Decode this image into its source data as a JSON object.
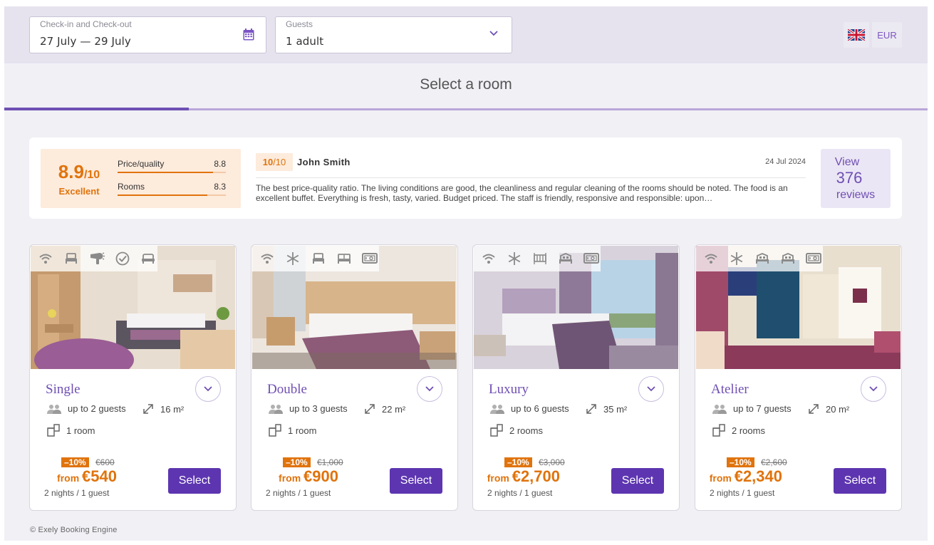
{
  "search": {
    "dates_label": "Check-in and Check-out",
    "dates_value": "27 July — 29 July",
    "guests_label": "Guests",
    "guests_value": "1 adult"
  },
  "header": {
    "currency": "EUR",
    "language_icon": "uk-flag-icon"
  },
  "page_title": "Select a room",
  "progress": {
    "fraction": 0.2
  },
  "rating": {
    "score": "8.9",
    "out_of": "/10",
    "word": "Excellent",
    "criteria": [
      {
        "name": "Price/quality",
        "value": "8.8",
        "fraction": 0.88
      },
      {
        "name": "Rooms",
        "value": "8.3",
        "fraction": 0.83
      }
    ]
  },
  "review": {
    "score": "10",
    "out_of": "/10",
    "author": "John Smith",
    "date": "24 Jul 2024",
    "text": "The best price-quality ratio. The living conditions are good, the cleanliness and regular cleaning of the rooms should be noted. The food is an excellent buffet. Everything is fresh, tasty, varied. Budget priced. The staff is friendly, responsive and responsible: upon…"
  },
  "reviews_button": {
    "line1": "View",
    "count": "376",
    "line3": "reviews"
  },
  "rooms": [
    {
      "name": "Single",
      "guests": "up to 2 guests",
      "area": "16 m²",
      "rooms": "1 room",
      "discount": "–10%",
      "old_price": "€600",
      "from": "from ",
      "price": "€540",
      "nights": "2 nights / 1 guest",
      "select": "Select",
      "amenities": [
        "wifi-icon",
        "bed-icon",
        "hairdryer-icon",
        "check-icon",
        "sofa-icon"
      ]
    },
    {
      "name": "Double",
      "guests": "up to 3 guests",
      "area": "22 m²",
      "rooms": "1 room",
      "discount": "–10%",
      "old_price": "€1,000",
      "from": "from ",
      "price": "€900",
      "nights": "2 nights / 1 guest",
      "select": "Select",
      "amenities": [
        "wifi-icon",
        "snowflake-icon",
        "bed-icon",
        "double-bed-icon",
        "safe-icon"
      ]
    },
    {
      "name": "Luxury",
      "guests": "up to 6 guests",
      "area": "35 m²",
      "rooms": "2 rooms",
      "discount": "–10%",
      "old_price": "€3,000",
      "from": "from ",
      "price": "€2,700",
      "nights": "2 nights / 1 guest",
      "select": "Select",
      "amenities": [
        "wifi-icon",
        "snowflake-icon",
        "crib-icon",
        "king-bed-icon",
        "safe-icon"
      ]
    },
    {
      "name": "Atelier",
      "guests": "up to 7 guests",
      "area": "20 m²",
      "rooms": "2 rooms",
      "discount": "–10%",
      "old_price": "€2,600",
      "from": "from ",
      "price": "€2,340",
      "nights": "2 nights / 1 guest",
      "select": "Select",
      "amenities": [
        "wifi-icon",
        "snowflake-icon",
        "king-bed-icon",
        "king-bed-icon",
        "safe-icon"
      ]
    }
  ],
  "footer": "© Exely Booking Engine",
  "colors": {
    "accent": "#6f4fb3",
    "button": "#5d35b0",
    "price": "#e0730c",
    "rating_bg": "#fdebdc"
  }
}
